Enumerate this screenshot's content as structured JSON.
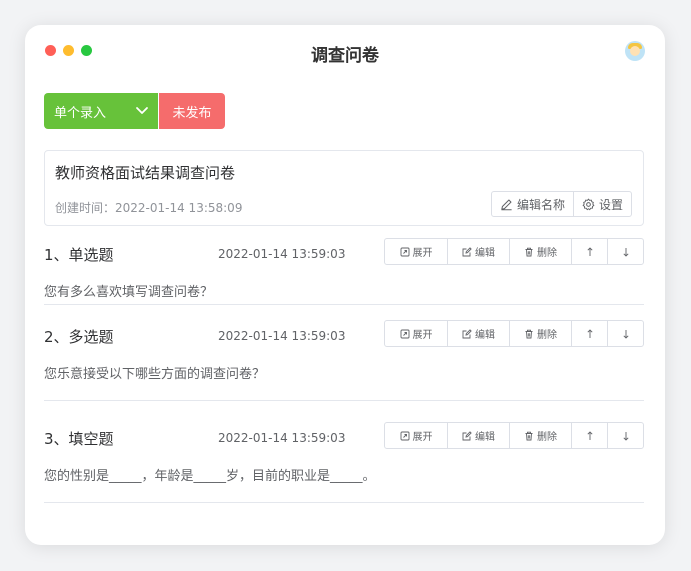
{
  "window": {
    "title": "调查问卷",
    "controls": [
      "close",
      "minimize",
      "maximize"
    ]
  },
  "toolbar": {
    "entry_mode_label": "单个录入",
    "publish_status_label": "未发布",
    "colors": {
      "entry": "#67c23a",
      "publish": "#f56c6c"
    }
  },
  "survey": {
    "name": "教师资格面试结果调查问卷",
    "created": "创建时间：2022-01-14 13:58:09",
    "edit_name_label": "编辑名称",
    "settings_label": "设置"
  },
  "question_actions": {
    "expand": "展开",
    "edit": "编辑",
    "delete": "删除",
    "move_up_icon": "arrow-up-icon",
    "move_down_icon": "arrow-down-icon"
  },
  "questions": [
    {
      "title": "1、单选题",
      "time": "2022-01-14 13:59:03",
      "text": "您有多么喜欢填写调查问卷？"
    },
    {
      "title": "2、多选题",
      "time": "2022-01-14 13:59:03",
      "text": "您乐意接受以下哪些方面的调查问卷？"
    },
    {
      "title": "3、填空题",
      "time": "2022-01-14 13:59:03",
      "text": "您的性别是_____，年龄是_____岁，目前的职业是_____。"
    }
  ]
}
